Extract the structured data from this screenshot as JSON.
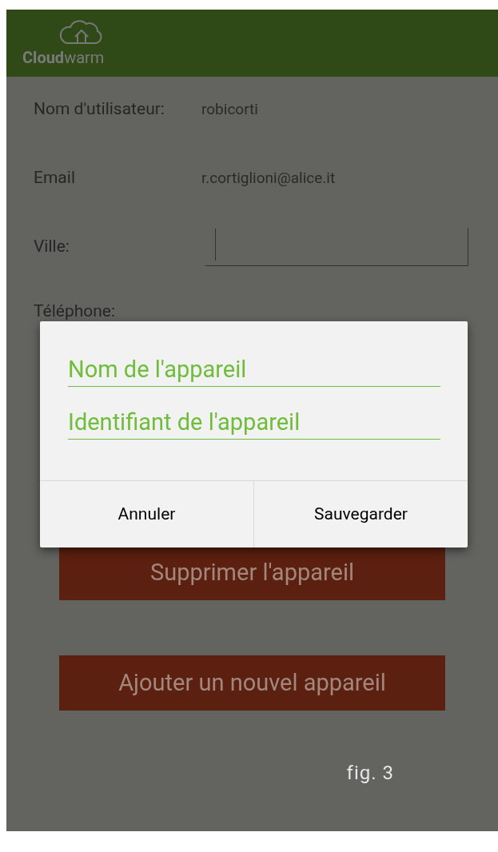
{
  "header": {
    "logo": {
      "bold": "Cloud",
      "light": "warm"
    }
  },
  "profile": [
    {
      "kind": "text",
      "label": "Nom d'utilisateur:",
      "value": "robicorti"
    },
    {
      "kind": "text",
      "label": "Email",
      "value": "r.cortiglioni@alice.it"
    },
    {
      "kind": "field",
      "label": "Ville:"
    },
    {
      "kind": "label",
      "label": "Téléphone:"
    }
  ],
  "buttons": [
    "Supprimer l'appareil",
    "Ajouter un nouvel appareil"
  ],
  "caption": "fig. 3",
  "dialog": {
    "fields": [
      {
        "placeholder": "Nom de l'appareil"
      },
      {
        "placeholder": "Identifiant de l'appareil"
      }
    ],
    "actions": [
      "Annuler",
      "Sauvegarder"
    ]
  }
}
